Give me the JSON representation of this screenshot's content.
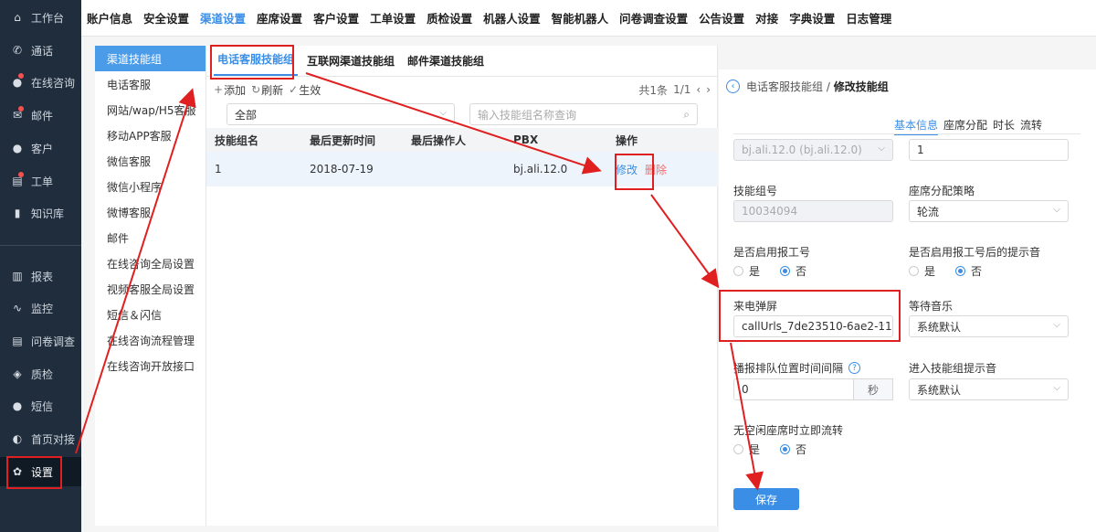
{
  "sidebar": {
    "items": [
      {
        "label": "工作台",
        "icon": "home-icon",
        "glyph": "⌂",
        "badge": false
      },
      {
        "label": "通话",
        "icon": "phone-icon",
        "glyph": "✆",
        "badge": false
      },
      {
        "label": "在线咨询",
        "icon": "chat-icon",
        "glyph": "●",
        "badge": true
      },
      {
        "label": "邮件",
        "icon": "mail-icon",
        "glyph": "✉",
        "badge": true
      },
      {
        "label": "客户",
        "icon": "user-icon",
        "glyph": "●",
        "badge": false
      },
      {
        "label": "工单",
        "icon": "ticket-icon",
        "glyph": "▤",
        "badge": true
      },
      {
        "label": "知识库",
        "icon": "book-icon",
        "glyph": "▮",
        "badge": false
      },
      {
        "label": "报表",
        "icon": "bar-chart-icon",
        "glyph": "▥",
        "badge": false
      },
      {
        "label": "监控",
        "icon": "pulse-icon",
        "glyph": "∿",
        "badge": false
      },
      {
        "label": "问卷调查",
        "icon": "survey-icon",
        "glyph": "▤",
        "badge": false
      },
      {
        "label": "质检",
        "icon": "shield-icon",
        "glyph": "◈",
        "badge": false
      },
      {
        "label": "短信",
        "icon": "message-icon",
        "glyph": "●",
        "badge": false
      },
      {
        "label": "首页对接",
        "icon": "link-icon",
        "glyph": "◐",
        "badge": false
      },
      {
        "label": "设置",
        "icon": "gear-icon",
        "glyph": "✿",
        "badge": false
      }
    ]
  },
  "topnav": {
    "items": [
      "账户信息",
      "安全设置",
      "渠道设置",
      "座席设置",
      "客户设置",
      "工单设置",
      "质检设置",
      "机器人设置",
      "智能机器人",
      "问卷调查设置",
      "公告设置",
      "对接",
      "字典设置",
      "日志管理"
    ],
    "active_index": 2
  },
  "submenu": {
    "items": [
      "渠道技能组",
      "电话客服",
      "网站/wap/H5客服",
      "移动APP客服",
      "微信客服",
      "微信小程序",
      "微博客服",
      "邮件",
      "在线咨询全局设置",
      "视频客服全局设置",
      "短信＆闪信",
      "在线咨询流程管理",
      "在线咨询开放接口"
    ]
  },
  "mid": {
    "tabs": [
      "电话客服技能组",
      "互联网渠道技能组",
      "邮件渠道技能组"
    ],
    "toolbar": {
      "add": "添加",
      "refresh": "刷新",
      "apply": "生效",
      "total": "共1条",
      "page": "1/1"
    },
    "filter": {
      "select_value": "全部",
      "search_placeholder": "输入技能组名称查询"
    },
    "table": {
      "headers": [
        "技能组名",
        "最后更新时间",
        "最后操作人",
        "PBX",
        "操作"
      ],
      "rows": [
        {
          "name": "1",
          "updated": "2018-07-19",
          "operator": "",
          "pbx": "bj.ali.12.0",
          "edit": "修改",
          "delete": "删除"
        }
      ]
    }
  },
  "right": {
    "breadcrumb_parent": "电话客服技能组",
    "breadcrumb_sep": " / ",
    "breadcrumb_current": "修改技能组",
    "tabs": [
      "基本信息",
      "座席分配",
      "时长",
      "流转"
    ],
    "pbx_value": "bj.ali.12.0 (bj.ali.12.0)",
    "name_value": "1",
    "group_no_label": "技能组号",
    "group_no_value": "10034094",
    "strategy_label": "座席分配策略",
    "strategy_value": "轮流",
    "report_no_label": "是否启用报工号",
    "report_tone_label": "是否启用报工号后的提示音",
    "yes": "是",
    "no": "否",
    "popup_label": "来电弹屏",
    "popup_value": "callUrls_7de23510-6ae2-11",
    "music_label": "等待音乐",
    "music_value": "系统默认",
    "queue_interval_label": "播报排队位置时间间隔",
    "queue_interval_value": "0",
    "queue_interval_unit": "秒",
    "enter_tone_label": "进入技能组提示音",
    "enter_tone_value": "系统默认",
    "idle_transfer_label": "无空闲座席时立即流转",
    "save_label": "保存"
  },
  "colors": {
    "accent": "#3a8ee6",
    "annotation": "#e02020",
    "sidebar_bg": "#1f2d3d"
  }
}
